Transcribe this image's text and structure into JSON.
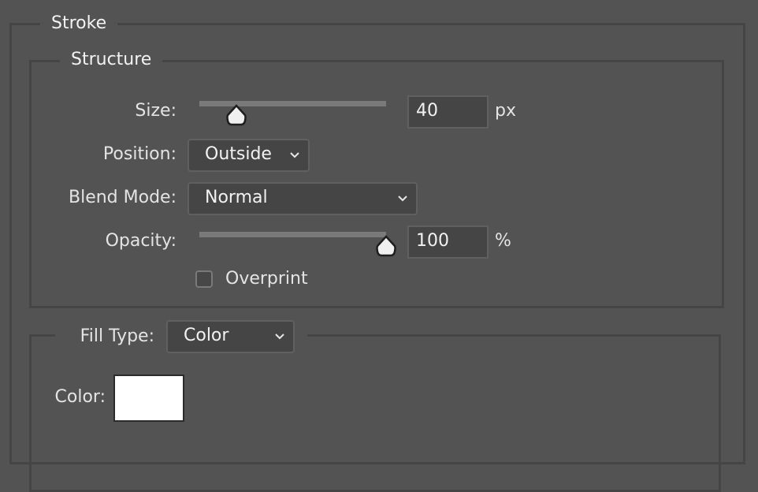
{
  "stroke": {
    "title": "Stroke",
    "structure": {
      "title": "Structure",
      "size": {
        "label": "Size:",
        "value": "40",
        "unit": "px",
        "slider_fraction": 0.2
      },
      "position": {
        "label": "Position:",
        "selected": "Outside"
      },
      "blend_mode": {
        "label": "Blend Mode:",
        "selected": "Normal"
      },
      "opacity": {
        "label": "Opacity:",
        "value": "100",
        "unit": "%",
        "slider_fraction": 1.0
      },
      "overprint": {
        "label": "Overprint",
        "checked": false
      }
    },
    "fill": {
      "type_label": "Fill Type:",
      "type_selected": "Color",
      "color_label": "Color:",
      "color_value": "#ffffff"
    }
  },
  "icons": {
    "slider_thumb": "pentagon-pointer",
    "dropdown": "chevron-down"
  }
}
